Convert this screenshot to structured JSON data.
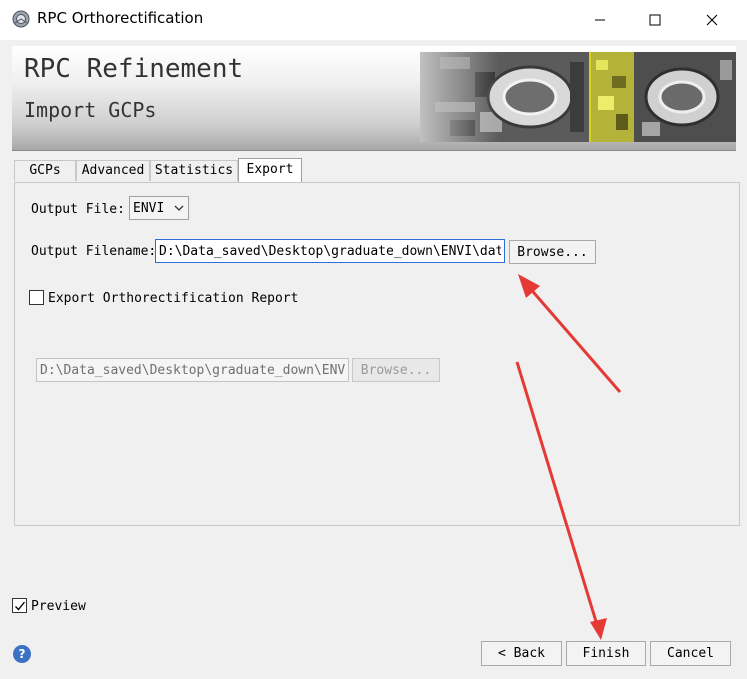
{
  "window": {
    "title": "RPC Orthorectification",
    "minimize_glyph": "—",
    "maximize_glyph": "☐",
    "close_glyph": "✕"
  },
  "banner": {
    "title": "RPC Refinement",
    "subtitle": "Import GCPs"
  },
  "tabs": [
    {
      "label": "GCPs"
    },
    {
      "label": "Advanced"
    },
    {
      "label": "Statistics"
    },
    {
      "label": "Export",
      "active": true
    }
  ],
  "export": {
    "output_file_label": "Output File:",
    "output_file_value": "ENVI",
    "output_filename_label": "Output Filename:",
    "output_filename_value": "D:\\Data_saved\\Desktop\\graduate_down\\ENVI\\data\\",
    "browse_label": "Browse...",
    "report_label": "Export Orthorectification Report",
    "report_checked": false,
    "report_path_value": "D:\\Data_saved\\Desktop\\graduate_down\\ENVI\\",
    "report_browse_label": "Browse..."
  },
  "footer": {
    "preview_label": "Preview",
    "preview_checked": true,
    "back_label": "< Back",
    "finish_label": "Finish",
    "cancel_label": "Cancel",
    "help_glyph": "?"
  },
  "icons": {
    "app": "app-window-icon",
    "help": "help-icon",
    "dropdown": "chevron-down-icon",
    "check": "checkmark-icon"
  },
  "colors": {
    "annotation_arrow": "#e53935",
    "input_focus_border": "#2b6ed7",
    "help_icon": "#3b72c4"
  }
}
